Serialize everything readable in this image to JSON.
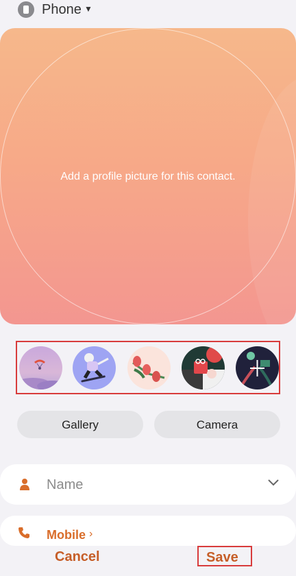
{
  "account": {
    "label": "Phone"
  },
  "photo": {
    "hint": "Add a profile picture for this contact."
  },
  "presets": [
    {
      "icon": "paraglider-avatar-icon"
    },
    {
      "icon": "skateboarder-avatar-icon"
    },
    {
      "icon": "tulips-avatar-icon"
    },
    {
      "icon": "gift-bag-avatar-icon"
    },
    {
      "icon": "flowers-avatar-icon"
    }
  ],
  "buttons": {
    "gallery": "Gallery",
    "camera": "Camera"
  },
  "form": {
    "name_placeholder": "Name",
    "mobile_label": "Mobile",
    "mobile_chevron": "›"
  },
  "actions": {
    "cancel": "Cancel",
    "save": "Save"
  },
  "colors": {
    "accent": "#c65e28",
    "highlight": "#d83b3b"
  }
}
